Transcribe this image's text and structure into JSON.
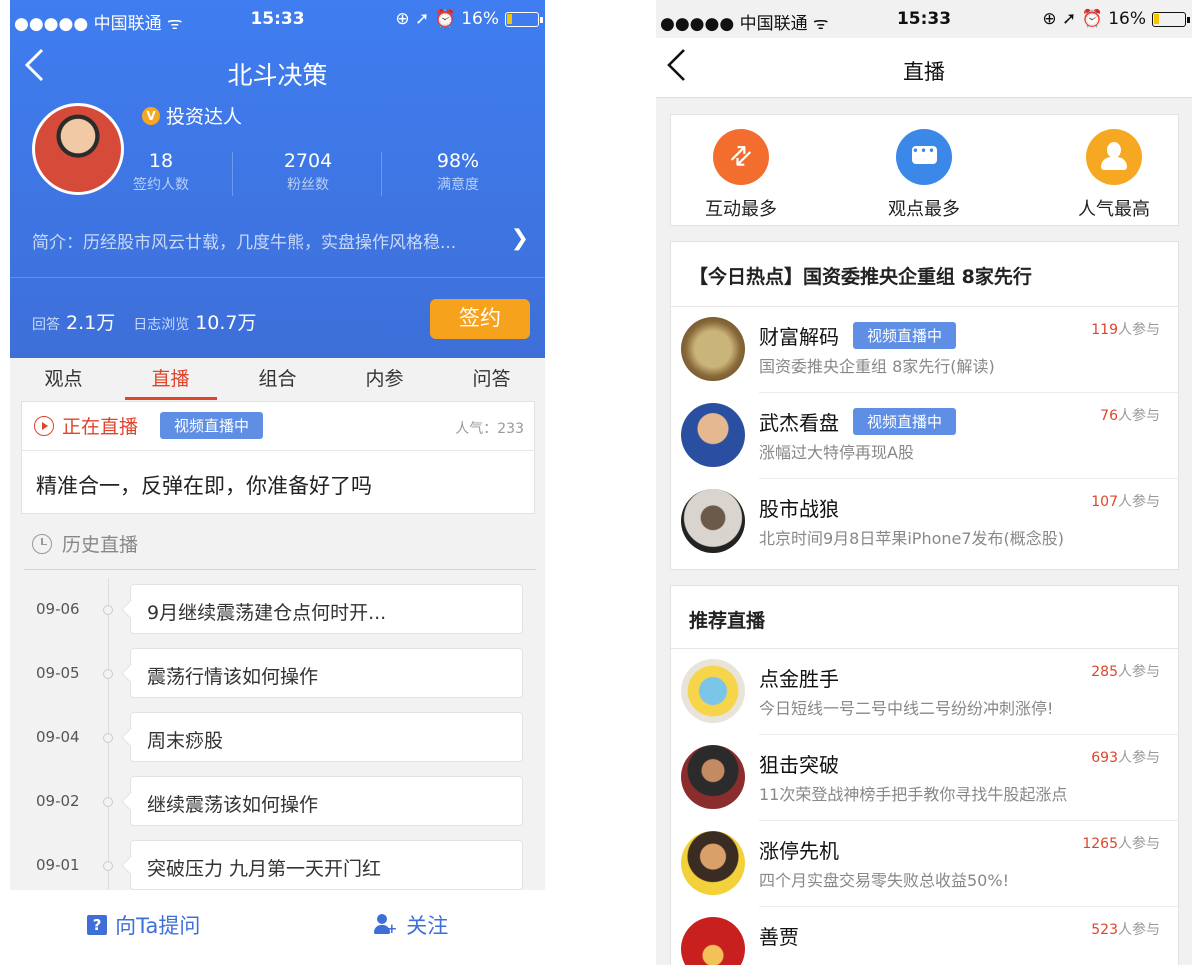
{
  "left": {
    "status_bar": {
      "carrier": "●●●●● 中国联通 ᯤ",
      "time": "15:33",
      "right": "⊕ ➚ ⏰ 16%"
    },
    "nav": {
      "title": "北斗决策"
    },
    "profile": {
      "badge": "投资达人",
      "badge_icon_letter": "V",
      "stats": [
        {
          "value": "18",
          "label": "签约人数"
        },
        {
          "value": "2704",
          "label": "粉丝数"
        },
        {
          "value": "98%",
          "label": "满意度"
        }
      ],
      "intro": "简介：历经股市风云廿载，几度牛熊，实盘操作风格稳...",
      "answers_label": "回答",
      "answers_value": "2.1万",
      "views_label": "日志浏览",
      "views_value": "10.7万",
      "sign_label": "签约"
    },
    "tabs": [
      {
        "label": "观点",
        "active": false
      },
      {
        "label": "直播",
        "active": true
      },
      {
        "label": "组合",
        "active": false
      },
      {
        "label": "内参",
        "active": false
      },
      {
        "label": "问答",
        "active": false
      }
    ],
    "live": {
      "label": "正在直播",
      "badge": "视频直播中",
      "popularity": "人气：233",
      "text": "精准合一，反弹在即，你准备好了吗"
    },
    "history": {
      "label": "历史直播",
      "items": [
        {
          "date": "09-06",
          "title": "9月继续震荡建仓点何时开..."
        },
        {
          "date": "09-05",
          "title": "震荡行情该如何操作"
        },
        {
          "date": "09-04",
          "title": "周末痧股"
        },
        {
          "date": "09-02",
          "title": "继续震荡该如何操作"
        },
        {
          "date": "09-01",
          "title": "突破压力 九月第一天开门红"
        }
      ]
    },
    "bottom": {
      "ask_label": "向Ta提问",
      "ask_icon_letter": "?",
      "follow_label": "关注"
    }
  },
  "right": {
    "status_bar": {
      "carrier": "●●●●● 中国联通 ᯤ",
      "time": "15:33",
      "right": "⊕ ➚ ⏰ 16%"
    },
    "nav": {
      "title": "直播"
    },
    "categories": [
      {
        "label": "互动最多",
        "icon": "interaction-arrows-icon",
        "color": "#f36e2e"
      },
      {
        "label": "观点最多",
        "icon": "chat-bubble-icon",
        "color": "#3b88e8"
      },
      {
        "label": "人气最高",
        "icon": "people-icon",
        "color": "#f7a823"
      }
    ],
    "hot": {
      "title": "【今日热点】国资委推央企重组 8家先行",
      "items": [
        {
          "name": "财富解码",
          "badge": "视频直播中",
          "desc": "国资委推央企重组 8家先行(解读)",
          "count": "119",
          "suffix": "人参与"
        },
        {
          "name": "武杰看盘",
          "badge": "视频直播中",
          "desc": "涨幅过大特停再现A股",
          "count": "76",
          "suffix": "人参与"
        },
        {
          "name": "股市战狼",
          "badge": "",
          "desc": "北京时间9月8日苹果iPhone7发布(概念股)",
          "count": "107",
          "suffix": "人参与"
        }
      ]
    },
    "recommend": {
      "title": "推荐直播",
      "items": [
        {
          "name": "点金胜手",
          "desc": "今日短线一号二号中线二号纷纷冲刺涨停!",
          "count": "285",
          "suffix": "人参与"
        },
        {
          "name": "狙击突破",
          "desc": "11次荣登战神榜手把手教你寻找牛股起涨点",
          "count": "693",
          "suffix": "人参与"
        },
        {
          "name": "涨停先机",
          "desc": "四个月实盘交易零失败总收益50%!",
          "count": "1265",
          "suffix": "人参与"
        },
        {
          "name": "善贾",
          "desc": "",
          "count": "523",
          "suffix": "人参与"
        }
      ]
    }
  }
}
